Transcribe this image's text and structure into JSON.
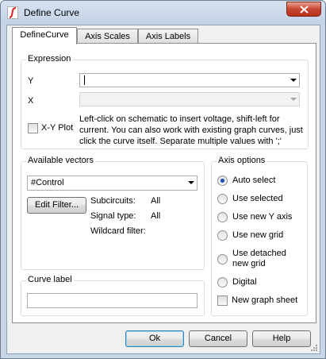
{
  "window": {
    "title": "Define Curve"
  },
  "tabs": [
    {
      "label": "DefineCurve",
      "active": true
    },
    {
      "label": "Axis Scales",
      "active": false
    },
    {
      "label": "Axis Labels",
      "active": false
    }
  ],
  "expression": {
    "group_label": "Expression",
    "y_label": "Y",
    "y_value": "",
    "x_label": "X",
    "x_value": "",
    "xy_plot_label": "X-Y Plot",
    "xy_plot_checked": false,
    "help_text": "Left-click on schematic to insert voltage, shift-left for current. You can also work with existing graph curves, just click the curve itself. Separate multiple values with ';'"
  },
  "available_vectors": {
    "group_label": "Available vectors",
    "selected": "#Control",
    "edit_filter_label": "Edit Filter...",
    "subcircuits_label": "Subcircuits:",
    "subcircuits_value": "All",
    "signal_type_label": "Signal type:",
    "signal_type_value": "All",
    "wildcard_label": "Wildcard filter:",
    "wildcard_value": ""
  },
  "curve_label": {
    "group_label": "Curve label",
    "value": ""
  },
  "axis_options": {
    "group_label": "Axis options",
    "options": [
      {
        "label": "Auto select",
        "checked": true
      },
      {
        "label": "Use selected",
        "checked": false
      },
      {
        "label": "Use new Y axis",
        "checked": false
      },
      {
        "label": "Use new grid",
        "checked": false
      },
      {
        "label": "Use detached\nnew grid",
        "checked": false
      },
      {
        "label": "Digital",
        "checked": false
      }
    ],
    "new_graph_sheet_label": "New graph sheet",
    "new_graph_sheet_checked": false
  },
  "buttons": {
    "ok": "Ok",
    "cancel": "Cancel",
    "help": "Help"
  },
  "colors": {
    "frame": "#c9d6e6",
    "close_button": "#c84630",
    "radio_dot": "#1f4fa8",
    "app_icon_red": "#e02020"
  }
}
